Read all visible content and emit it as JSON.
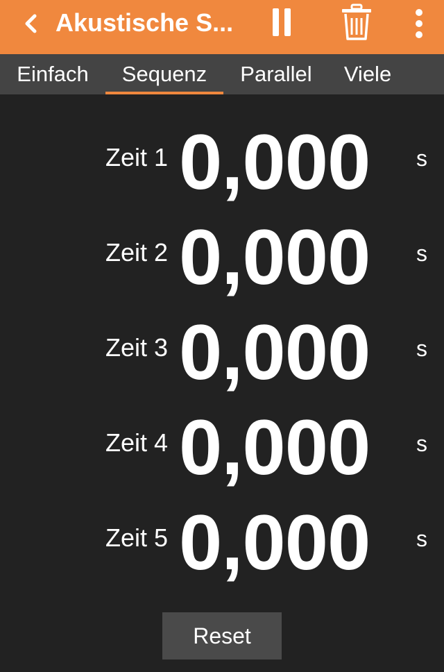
{
  "appbar": {
    "title": "Akustische S...",
    "color": "#f0883e"
  },
  "icons": {
    "back": "chevron-left-icon",
    "pause": "pause-icon",
    "delete": "trash-icon",
    "menu": "more-vertical-icon"
  },
  "tabs": [
    {
      "label": "Einfach",
      "active": false
    },
    {
      "label": "Sequenz",
      "active": true
    },
    {
      "label": "Parallel",
      "active": false
    },
    {
      "label": "Viele",
      "active": false
    }
  ],
  "timers": [
    {
      "label": "Zeit 1",
      "value": "0,000",
      "unit": "s"
    },
    {
      "label": "Zeit 2",
      "value": "0,000",
      "unit": "s"
    },
    {
      "label": "Zeit 3",
      "value": "0,000",
      "unit": "s"
    },
    {
      "label": "Zeit 4",
      "value": "0,000",
      "unit": "s"
    },
    {
      "label": "Zeit 5",
      "value": "0,000",
      "unit": "s"
    }
  ],
  "reset_label": "Reset",
  "colors": {
    "background": "#222222",
    "tabbar": "#444444",
    "accent": "#f0883e",
    "button": "#4a4a4a"
  }
}
